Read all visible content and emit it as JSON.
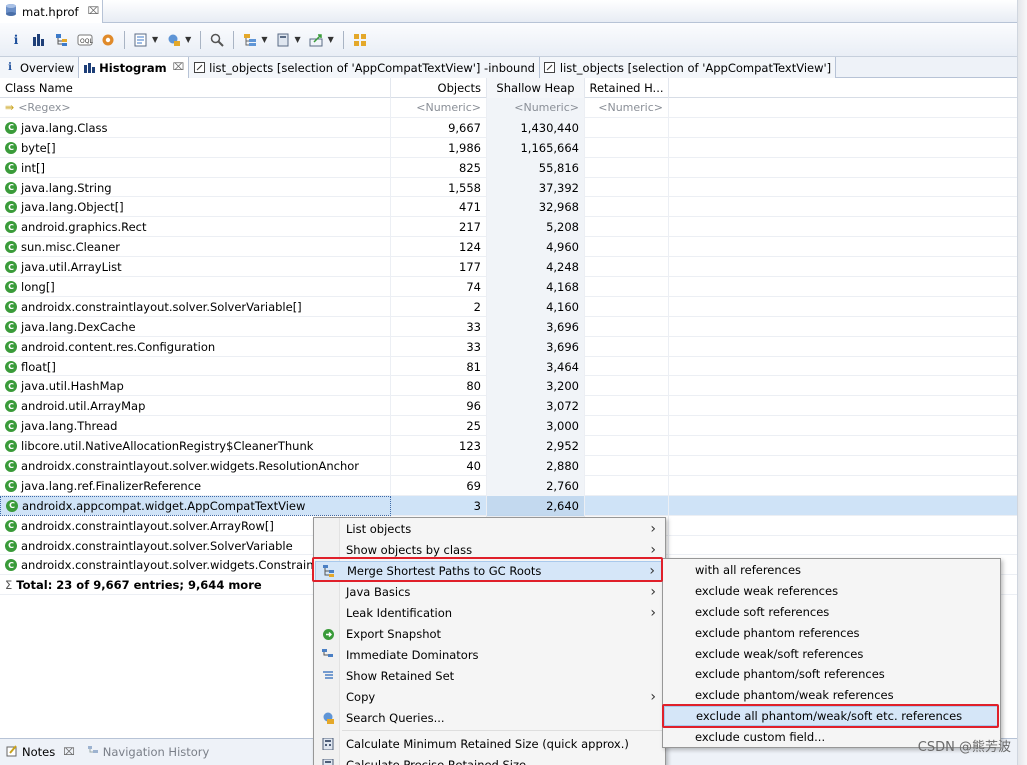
{
  "editor_tab": {
    "label": "mat.hprof",
    "close": "⌧"
  },
  "view_tabs": [
    {
      "label": "Overview",
      "icon": "info-icon",
      "active": false
    },
    {
      "label": "Histogram",
      "icon": "histogram-icon",
      "active": true,
      "close": "⌧"
    },
    {
      "label": "list_objects  [selection of 'AppCompatTextView'] -inbound",
      "icon": "list-objects-icon",
      "active": false
    },
    {
      "label": "list_objects  [selection of 'AppCompatTextView']",
      "icon": "list-objects-icon",
      "active": false
    }
  ],
  "columns": {
    "name": "Class Name",
    "objects": "Objects",
    "shallow": "Shallow Heap",
    "retained": "Retained H..."
  },
  "filter": {
    "name": "<Regex>",
    "objects": "<Numeric>",
    "shallow": "<Numeric>",
    "retained": "<Numeric>"
  },
  "rows": [
    {
      "name": "java.lang.Class",
      "objects": "9,667",
      "shallow": "1,430,440",
      "retained": ""
    },
    {
      "name": "byte[]",
      "objects": "1,986",
      "shallow": "1,165,664",
      "retained": ""
    },
    {
      "name": "int[]",
      "objects": "825",
      "shallow": "55,816",
      "retained": ""
    },
    {
      "name": "java.lang.String",
      "objects": "1,558",
      "shallow": "37,392",
      "retained": ""
    },
    {
      "name": "java.lang.Object[]",
      "objects": "471",
      "shallow": "32,968",
      "retained": ""
    },
    {
      "name": "android.graphics.Rect",
      "objects": "217",
      "shallow": "5,208",
      "retained": ""
    },
    {
      "name": "sun.misc.Cleaner",
      "objects": "124",
      "shallow": "4,960",
      "retained": ""
    },
    {
      "name": "java.util.ArrayList",
      "objects": "177",
      "shallow": "4,248",
      "retained": ""
    },
    {
      "name": "long[]",
      "objects": "74",
      "shallow": "4,168",
      "retained": ""
    },
    {
      "name": "androidx.constraintlayout.solver.SolverVariable[]",
      "objects": "2",
      "shallow": "4,160",
      "retained": ""
    },
    {
      "name": "java.lang.DexCache",
      "objects": "33",
      "shallow": "3,696",
      "retained": ""
    },
    {
      "name": "android.content.res.Configuration",
      "objects": "33",
      "shallow": "3,696",
      "retained": ""
    },
    {
      "name": "float[]",
      "objects": "81",
      "shallow": "3,464",
      "retained": ""
    },
    {
      "name": "java.util.HashMap",
      "objects": "80",
      "shallow": "3,200",
      "retained": ""
    },
    {
      "name": "android.util.ArrayMap",
      "objects": "96",
      "shallow": "3,072",
      "retained": ""
    },
    {
      "name": "java.lang.Thread",
      "objects": "25",
      "shallow": "3,000",
      "retained": ""
    },
    {
      "name": "libcore.util.NativeAllocationRegistry$CleanerThunk",
      "objects": "123",
      "shallow": "2,952",
      "retained": ""
    },
    {
      "name": "androidx.constraintlayout.solver.widgets.ResolutionAnchor",
      "objects": "40",
      "shallow": "2,880",
      "retained": ""
    },
    {
      "name": "java.lang.ref.FinalizerReference",
      "objects": "69",
      "shallow": "2,760",
      "retained": ""
    },
    {
      "name": "androidx.appcompat.widget.AppCompatTextView",
      "objects": "3",
      "shallow": "2,640",
      "retained": "",
      "selected": true
    },
    {
      "name": "androidx.constraintlayout.solver.ArrayRow[]",
      "objects": "",
      "shallow": "",
      "retained": ""
    },
    {
      "name": "androidx.constraintlayout.solver.SolverVariable",
      "objects": "",
      "shallow": "",
      "retained": ""
    },
    {
      "name": "androidx.constraintlayout.solver.widgets.ConstraintAr",
      "objects": "",
      "shallow": "",
      "retained": ""
    }
  ],
  "total": "Total: 23 of 9,667 entries; 9,644 more",
  "context_menu": [
    {
      "label": "List objects",
      "submenu": true,
      "icon": ""
    },
    {
      "label": "Show objects by class",
      "submenu": true,
      "icon": ""
    },
    {
      "label": "Merge Shortest Paths to GC Roots",
      "submenu": true,
      "icon": "merge-paths-icon",
      "highlighted": true
    },
    {
      "label": "Java Basics",
      "submenu": true,
      "icon": ""
    },
    {
      "label": "Leak Identification",
      "submenu": true,
      "icon": ""
    },
    {
      "label": "Export Snapshot",
      "submenu": false,
      "icon": "export-icon"
    },
    {
      "label": "Immediate Dominators",
      "submenu": false,
      "icon": "dominators-icon"
    },
    {
      "label": "Show Retained Set",
      "submenu": false,
      "icon": "retained-set-icon"
    },
    {
      "label": "Copy",
      "submenu": true,
      "icon": ""
    },
    {
      "label": "Search Queries...",
      "submenu": false,
      "icon": "search-queries-icon"
    },
    {
      "label": "Calculate Minimum Retained Size (quick approx.)",
      "submenu": false,
      "icon": "calculator-icon"
    },
    {
      "label": "Calculate Precise Retained Size",
      "submenu": false,
      "icon": "calculator-icon"
    }
  ],
  "submenu": [
    {
      "label": "with all references"
    },
    {
      "label": "exclude weak references"
    },
    {
      "label": "exclude soft references"
    },
    {
      "label": "exclude phantom references"
    },
    {
      "label": "exclude weak/soft references"
    },
    {
      "label": "exclude phantom/soft references"
    },
    {
      "label": "exclude phantom/weak references"
    },
    {
      "label": "exclude all phantom/weak/soft etc. references",
      "highlighted": true
    },
    {
      "label": "exclude custom field..."
    }
  ],
  "bottom_tabs": [
    {
      "label": "Notes",
      "close": "⌧",
      "active": true
    },
    {
      "label": "Navigation History",
      "active": false
    }
  ],
  "watermark": "CSDN @熊芳波",
  "colors": {
    "highlight_box": "#e0202a",
    "class_icon": "#3a9b3a",
    "selection": "#cfe3f7"
  }
}
